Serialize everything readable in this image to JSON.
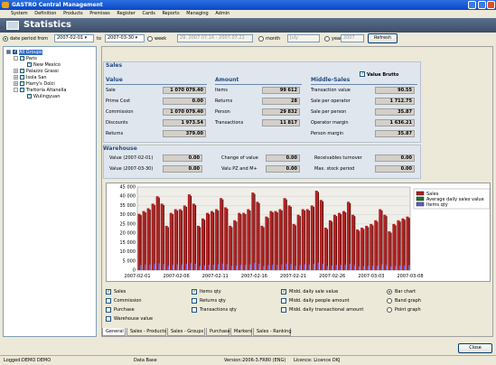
{
  "window": {
    "title": "GASTRO Central Management"
  },
  "menu": [
    "System",
    "Definition",
    "Products",
    "Premises",
    "Register",
    "Cards",
    "Reports",
    "Managing",
    "Admin"
  ],
  "header": {
    "title": "Statistics"
  },
  "filter": {
    "date_period_label": "date period from",
    "date_from": "2007-02-01",
    "to_label": "to",
    "date_to": "2007-03-30",
    "week_label": "week",
    "week_value": "29. 2007 07.16 - 2007.07.22",
    "month_label": "month",
    "month_value": "July",
    "year_label": "year",
    "year_value": "2007",
    "refresh_label": "Refresh"
  },
  "tree": {
    "items": [
      {
        "label": "All Groups",
        "level": 0,
        "checked": true,
        "selected": true,
        "expander": "-"
      },
      {
        "label": "Paris",
        "level": 1,
        "checked": true,
        "expander": "-"
      },
      {
        "label": "New Mexico",
        "level": 2,
        "checked": true,
        "expander": ""
      },
      {
        "label": "Palazzo Grassi",
        "level": 1,
        "checked": true,
        "expander": "+"
      },
      {
        "label": "Isola San",
        "level": 1,
        "checked": true,
        "expander": "+"
      },
      {
        "label": "Harry's Dolci",
        "level": 1,
        "checked": true,
        "expander": "+"
      },
      {
        "label": "Trattoria Altanella",
        "level": 1,
        "checked": true,
        "expander": "-"
      },
      {
        "label": "Wulingyuan",
        "level": 2,
        "checked": true,
        "expander": ""
      }
    ]
  },
  "sales": {
    "title": "Sales",
    "value_brutto_label": "Value Brutto",
    "value": {
      "title": "Value",
      "rows": [
        {
          "label": "Sale",
          "value": "1 070 079.40"
        },
        {
          "label": "Prime Cost",
          "value": "0.00"
        },
        {
          "label": "Commission",
          "value": "1 070 079.40"
        },
        {
          "label": "Discounts",
          "value": "1 973.54"
        },
        {
          "label": "Returns",
          "value": "379.00"
        }
      ]
    },
    "amount": {
      "title": "Amount",
      "rows": [
        {
          "label": "Items",
          "value": "99 612"
        },
        {
          "label": "Returns",
          "value": "28"
        },
        {
          "label": "Person",
          "value": "29 832"
        },
        {
          "label": "Transactions",
          "value": "11 817"
        }
      ]
    },
    "middle": {
      "title": "Middle-Sales",
      "rows": [
        {
          "label": "Transaction value",
          "value": "90.55"
        },
        {
          "label": "Sale per operator",
          "value": "1 712.75"
        },
        {
          "label": "Sale per person",
          "value": "35.87"
        },
        {
          "label": "Operator margin",
          "value": "1 636.21"
        },
        {
          "label": "Person margin",
          "value": "35.87"
        }
      ]
    }
  },
  "warehouse": {
    "title": "Warehouse",
    "rows": [
      [
        {
          "label": "Value (2007-02-01)",
          "value": "0.00"
        },
        {
          "label": "Change of value",
          "value": "0.00"
        },
        {
          "label": "Receivables turnover",
          "value": "0.00"
        }
      ],
      [
        {
          "label": "Value (2007-03-30)",
          "value": "0.00"
        },
        {
          "label": "Valu PZ and M+",
          "value": "0.00"
        },
        {
          "label": "Max. stock period",
          "value": "0.00"
        }
      ]
    ]
  },
  "chart_data": {
    "type": "bar",
    "ylim": [
      0,
      45000
    ],
    "yticks": [
      "0",
      "5 000",
      "10 000",
      "15 000",
      "20 000",
      "25 000",
      "30 000",
      "35 000",
      "40 000",
      "45 000"
    ],
    "xticks": [
      "2007-02-01",
      "2007-02-06",
      "2007-02-11",
      "2007-02-16",
      "2007-02-21",
      "2007-02-26",
      "2007-03-03",
      "2007-03-08"
    ],
    "legend_position": "top-right",
    "series": [
      {
        "name": "Sales",
        "color": "#b22222",
        "values": [
          30500,
          32000,
          33500,
          36000,
          40000,
          36000,
          24000,
          31000,
          33000,
          33000,
          35000,
          41000,
          36000,
          24000,
          28000,
          31000,
          32000,
          33000,
          39000,
          34000,
          24000,
          27000,
          31000,
          31000,
          33000,
          42000,
          37000,
          24000,
          29000,
          32000,
          32000,
          33000,
          39000,
          35000,
          25000,
          30000,
          33000,
          33000,
          35000,
          43000,
          38000,
          23000,
          27000,
          30000,
          31000,
          32000,
          37000,
          30000,
          22000,
          23000,
          24000,
          25000,
          27000,
          33000,
          30000,
          21000,
          25000,
          27000,
          28000,
          29000
        ]
      },
      {
        "name": "Average daily sales value",
        "color": "#1a7a2a",
        "values": []
      },
      {
        "name": "Items qty",
        "color": "#6a5acd",
        "values": [
          2800,
          3000,
          3100,
          3300,
          3700,
          3300,
          2300,
          2900,
          3100,
          3100,
          3300,
          3800,
          3400,
          2300,
          2600,
          2900,
          3000,
          3100,
          3600,
          3200,
          2300,
          2500,
          2900,
          2900,
          3100,
          3900,
          3400,
          2300,
          2700,
          3000,
          3000,
          3100,
          3600,
          3300,
          2400,
          2800,
          3100,
          3100,
          3300,
          4000,
          3500,
          2200,
          2500,
          2800,
          2900,
          3000,
          3400,
          2800,
          2100,
          2200,
          2300,
          2400,
          2500,
          3100,
          2800,
          2000,
          2300,
          2500,
          2600,
          2700
        ]
      }
    ]
  },
  "options": {
    "col1": [
      {
        "label": "Sales",
        "checked": true
      },
      {
        "label": "Commission",
        "checked": false
      },
      {
        "label": "Purchase",
        "checked": false
      },
      {
        "label": "Warehouse value",
        "checked": false
      }
    ],
    "col2": [
      {
        "label": "Items qty",
        "checked": true
      },
      {
        "label": "Returns qty",
        "checked": false
      },
      {
        "label": "Transactions qty",
        "checked": false
      }
    ],
    "col3": [
      {
        "label": "Midd. daily sale value",
        "checked": true
      },
      {
        "label": "Midd. daily people amount",
        "checked": false
      },
      {
        "label": "Midd. daily transactional amount",
        "checked": false
      }
    ],
    "col4": [
      {
        "label": "Bar chart",
        "checked": true
      },
      {
        "label": "Band graph",
        "checked": false
      },
      {
        "label": "Point graph",
        "checked": false
      }
    ]
  },
  "tabs": [
    "General",
    "Sales - Products",
    "Sales - Groups",
    "Purchase",
    "Markers",
    "Sales - Ranking"
  ],
  "active_tab": "General",
  "close_label": "Close",
  "status": {
    "user": "Logged:DEMO DEMO",
    "db": "Data Base",
    "version": "Version:2006-3.FR80 (ENG)",
    "licence": "Licence: Licence DKJ"
  }
}
